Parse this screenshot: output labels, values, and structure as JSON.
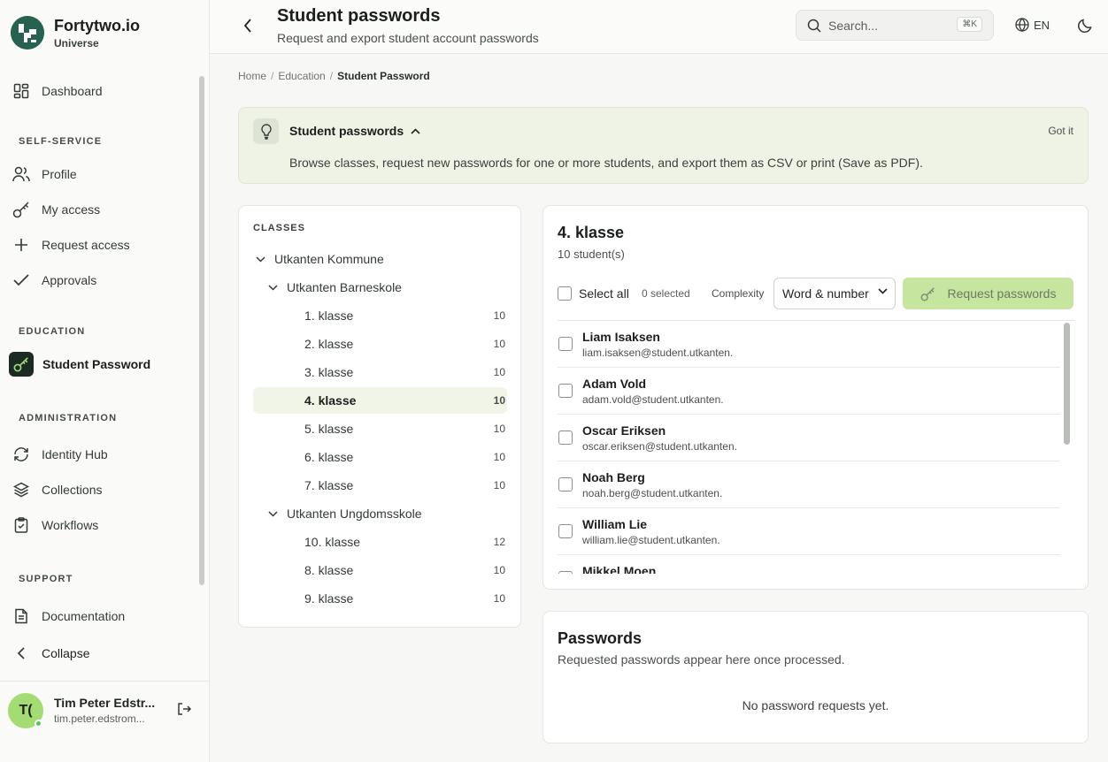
{
  "brand": {
    "title": "Fortytwo.io",
    "subtitle": "Universe"
  },
  "sidebar": {
    "dashboard": "Dashboard",
    "sections": {
      "self_service": "SELF-SERVICE",
      "education": "EDUCATION",
      "administration": "ADMINISTRATION",
      "support": "SUPPORT"
    },
    "items": {
      "profile": "Profile",
      "my_access": "My access",
      "request_access": "Request access",
      "approvals": "Approvals",
      "student_password": "Student Password",
      "identity_hub": "Identity Hub",
      "collections": "Collections",
      "workflows": "Workflows",
      "documentation": "Documentation",
      "collapse": "Collapse"
    },
    "user": {
      "initials": "T(",
      "name": "Tim Peter Edstr...",
      "email": "tim.peter.edstrom..."
    }
  },
  "header": {
    "title": "Student passwords",
    "subtitle": "Request and export student account passwords",
    "search_placeholder": "Search...",
    "search_shortcut": "⌘K",
    "language": "EN"
  },
  "breadcrumb": {
    "home": "Home",
    "education": "Education",
    "current": "Student Password",
    "sep": "/"
  },
  "banner": {
    "title": "Student passwords",
    "dismiss": "Got it",
    "description": "Browse classes, request new passwords for one or more students, and export them as CSV or print (Save as PDF)."
  },
  "classes": {
    "heading": "CLASSES",
    "municipality": "Utkanten Kommune",
    "schools": [
      {
        "name": "Utkanten Barneskole",
        "classes": [
          {
            "name": "1. klasse",
            "count": "10"
          },
          {
            "name": "2. klasse",
            "count": "10"
          },
          {
            "name": "3. klasse",
            "count": "10"
          },
          {
            "name": "4. klasse",
            "count": "10"
          },
          {
            "name": "5. klasse",
            "count": "10"
          },
          {
            "name": "6. klasse",
            "count": "10"
          },
          {
            "name": "7. klasse",
            "count": "10"
          }
        ]
      },
      {
        "name": "Utkanten Ungdomsskole",
        "classes": [
          {
            "name": "10. klasse",
            "count": "12"
          },
          {
            "name": "8. klasse",
            "count": "10"
          },
          {
            "name": "9. klasse",
            "count": "10"
          }
        ]
      }
    ]
  },
  "students_panel": {
    "title": "4. klasse",
    "count": "10 student(s)",
    "select_all": "Select all",
    "selected": "0 selected",
    "complexity_label": "Complexity",
    "complexity_value": "Word & number",
    "request_button": "Request passwords",
    "students": [
      {
        "name": "Liam Isaksen",
        "email": "liam.isaksen@student.utkanten."
      },
      {
        "name": "Adam Vold",
        "email": "adam.vold@student.utkanten."
      },
      {
        "name": "Oscar Eriksen",
        "email": "oscar.eriksen@student.utkanten."
      },
      {
        "name": "Noah Berg",
        "email": "noah.berg@student.utkanten."
      },
      {
        "name": "William Lie",
        "email": "william.lie@student.utkanten."
      },
      {
        "name": "Mikkel Moen",
        "email": ""
      }
    ]
  },
  "passwords": {
    "title": "Passwords",
    "subtitle": "Requested passwords appear here once processed.",
    "empty": "No password requests yet."
  },
  "colors": {
    "accent": "#a3dc72",
    "brand": "#27614f",
    "banner_bg": "#eef3e6",
    "button_disabled": "#c6e6a0"
  }
}
